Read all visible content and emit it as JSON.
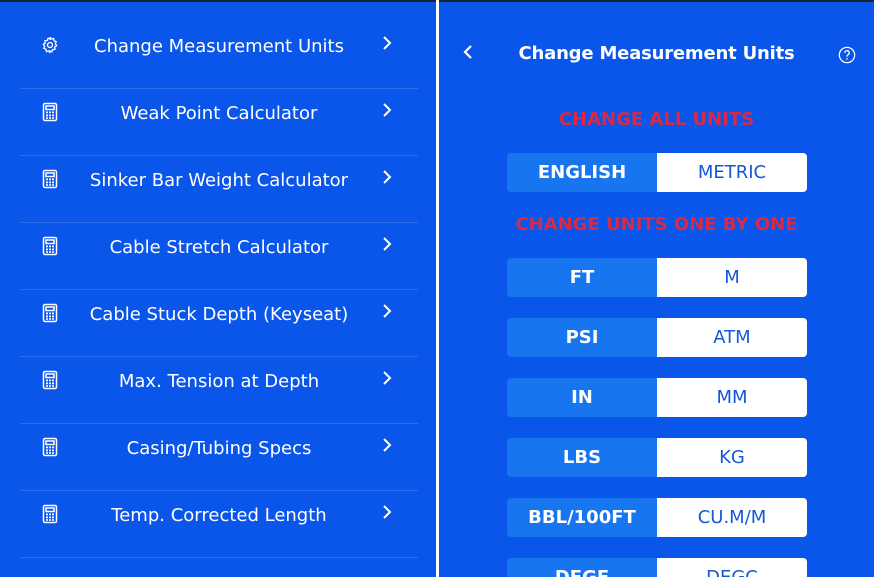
{
  "colors": {
    "background": "#0a55ea",
    "section_title": "#d82a44",
    "toggle_active": "#1875f0",
    "toggle_inactive_text": "#1558d6"
  },
  "menu": {
    "items": [
      {
        "label": "Change Measurement Units",
        "icon": "gear-icon"
      },
      {
        "label": "Weak Point Calculator",
        "icon": "calculator-icon"
      },
      {
        "label": "Sinker Bar Weight Calculator",
        "icon": "calculator-icon"
      },
      {
        "label": "Cable Stretch Calculator",
        "icon": "calculator-icon"
      },
      {
        "label": "Cable Stuck Depth (Keyseat)",
        "icon": "calculator-icon"
      },
      {
        "label": "Max. Tension at Depth",
        "icon": "calculator-icon"
      },
      {
        "label": "Casing/Tubing Specs",
        "icon": "calculator-icon"
      },
      {
        "label": "Temp. Corrected Length",
        "icon": "calculator-icon"
      }
    ]
  },
  "panel": {
    "title": "Change Measurement Units",
    "section_all": "CHANGE ALL UNITS",
    "section_each": "CHANGE UNITS ONE BY ONE",
    "all_units": {
      "left": "ENGLISH",
      "right": "METRIC",
      "selected": "left"
    },
    "unit_pairs": [
      {
        "left": "FT",
        "right": "M",
        "selected": "left"
      },
      {
        "left": "PSI",
        "right": "ATM",
        "selected": "left"
      },
      {
        "left": "IN",
        "right": "MM",
        "selected": "left"
      },
      {
        "left": "LBS",
        "right": "KG",
        "selected": "left"
      },
      {
        "left": "BBL/100FT",
        "right": "CU.M/M",
        "selected": "left"
      },
      {
        "left": "DEGF",
        "right": "DEGC",
        "selected": "left"
      }
    ]
  }
}
